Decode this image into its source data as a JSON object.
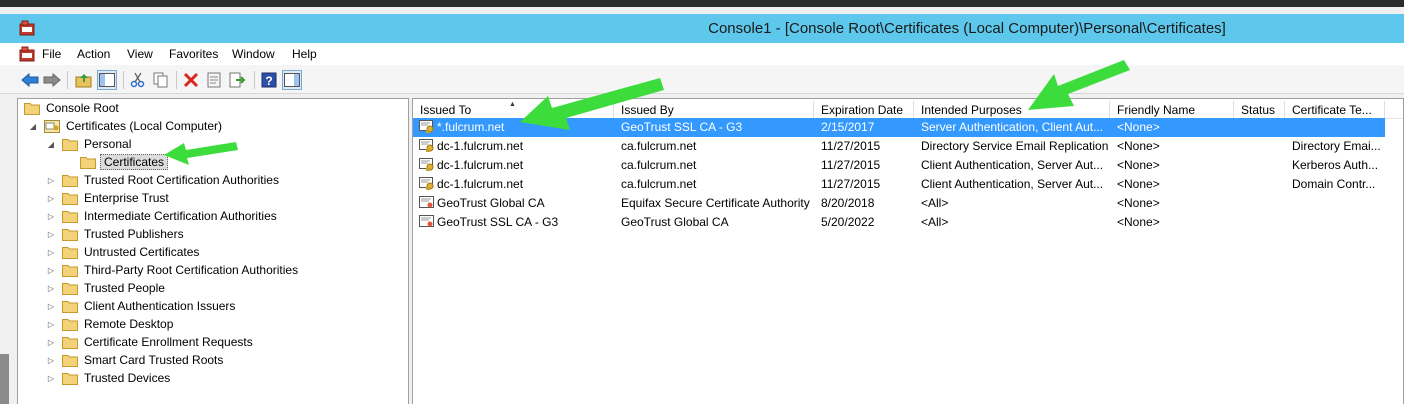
{
  "window": {
    "title": "Console1 - [Console Root\\Certificates (Local Computer)\\Personal\\Certificates]"
  },
  "menu": [
    "File",
    "Action",
    "View",
    "Favorites",
    "Window",
    "Help"
  ],
  "toolbar": {
    "buttons": [
      "back-icon",
      "forward-icon",
      "up-folder-icon",
      "show-hide-tree-icon",
      "cut-icon",
      "copy-icon",
      "delete-icon",
      "properties-icon",
      "export-icon",
      "help-icon",
      "action-pane-icon"
    ]
  },
  "tree": {
    "root": "Console Root",
    "computer": "Certificates (Local Computer)",
    "personal": "Personal",
    "certificates": "Certificates",
    "stores": [
      "Trusted Root Certification Authorities",
      "Enterprise Trust",
      "Intermediate Certification Authorities",
      "Trusted Publishers",
      "Untrusted Certificates",
      "Third-Party Root Certification Authorities",
      "Trusted People",
      "Client Authentication Issuers",
      "Remote Desktop",
      "Certificate Enrollment Requests",
      "Smart Card Trusted Roots",
      "Trusted Devices"
    ]
  },
  "list": {
    "columns": [
      "Issued To",
      "Issued By",
      "Expiration Date",
      "Intended Purposes",
      "Friendly Name",
      "Status",
      "Certificate Te..."
    ],
    "rows": [
      [
        "*.fulcrum.net",
        "GeoTrust SSL CA - G3",
        "2/15/2017",
        "Server Authentication, Client Aut...",
        "<None>",
        "",
        ""
      ],
      [
        "dc-1.fulcrum.net",
        "ca.fulcrum.net",
        "11/27/2015",
        "Directory Service Email Replication",
        "<None>",
        "",
        "Directory Emai..."
      ],
      [
        "dc-1.fulcrum.net",
        "ca.fulcrum.net",
        "11/27/2015",
        "Client Authentication, Server Aut...",
        "<None>",
        "",
        "Kerberos Auth..."
      ],
      [
        "dc-1.fulcrum.net",
        "ca.fulcrum.net",
        "11/27/2015",
        "Client Authentication, Server Aut...",
        "<None>",
        "",
        "Domain Contr..."
      ],
      [
        "GeoTrust Global CA",
        "Equifax Secure Certificate Authority",
        "8/20/2018",
        "<All>",
        "<None>",
        "",
        ""
      ],
      [
        "GeoTrust SSL CA - G3",
        "GeoTrust Global CA",
        "5/20/2022",
        "<All>",
        "<None>",
        "",
        ""
      ]
    ]
  },
  "colors": {
    "titlebar": "#5ec8ec",
    "selection": "#3399ff",
    "annotation_arrow": "#3ddc3d"
  }
}
